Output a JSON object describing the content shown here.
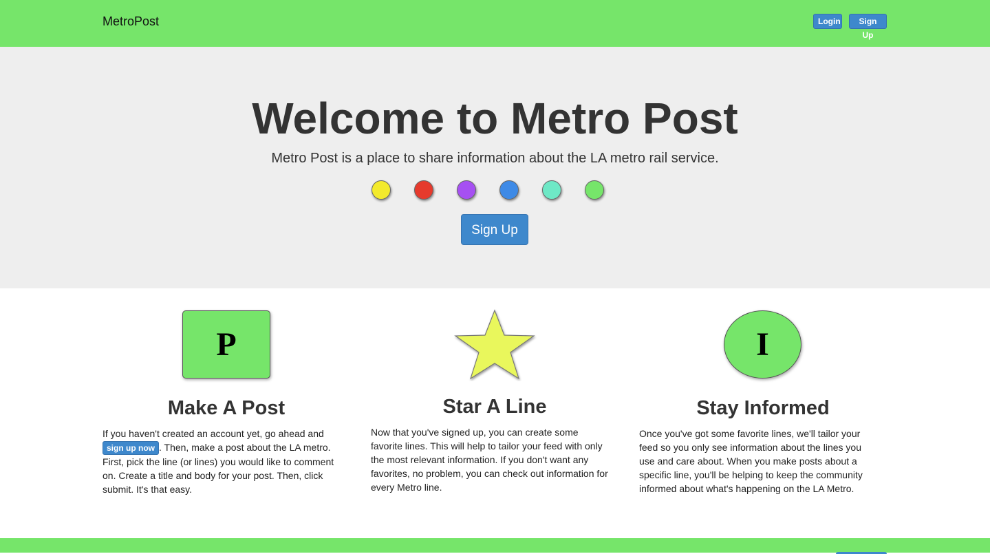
{
  "navbar": {
    "brand": "MetroPost",
    "login_label": "Login",
    "signup_label": "Sign Up",
    "background_color": "#76e56a",
    "button_color": "#3e88cc"
  },
  "hero": {
    "title": "Welcome to Metro Post",
    "subtitle": "Metro Post is a place to share information about the LA metro rail service.",
    "line_dots": [
      {
        "name": "yellow",
        "color": "#f3ea2c"
      },
      {
        "name": "red",
        "color": "#e63a2d"
      },
      {
        "name": "purple",
        "color": "#a650f2"
      },
      {
        "name": "blue",
        "color": "#3e8ae6"
      },
      {
        "name": "teal",
        "color": "#6ee8c6"
      },
      {
        "name": "green",
        "color": "#76e56a"
      }
    ],
    "signup_label": "Sign Up",
    "background_color": "#eeeeee"
  },
  "features": [
    {
      "icon_letter": "P",
      "icon_name": "post-icon",
      "title": "Make A Post",
      "text_before": "If you haven't created an account yet, go ahead and ",
      "inline_button_label": "sign up now",
      "text_after": ". Then, make a post about the LA metro. First, pick the line (or lines) you would like to comment on. Create a title and body for your post. Then, click submit. It's that easy."
    },
    {
      "icon_name": "star-icon",
      "icon_color": "#e9f75c",
      "title": "Star A Line",
      "text": "Now that you've signed up, you can create some favorite lines. This will help to tailor your feed with only the most relevant information. If you don't want any favorites, no problem, you can check out information for every Metro line."
    },
    {
      "icon_letter": "I",
      "icon_name": "info-icon",
      "title": "Stay Informed",
      "text": "Once you've got some favorite lines, we'll tailor your feed so you only see information about the lines you use and care about. When you make posts about a specific line, you'll be helping to keep the community informed about what's happening on the LA Metro."
    }
  ]
}
